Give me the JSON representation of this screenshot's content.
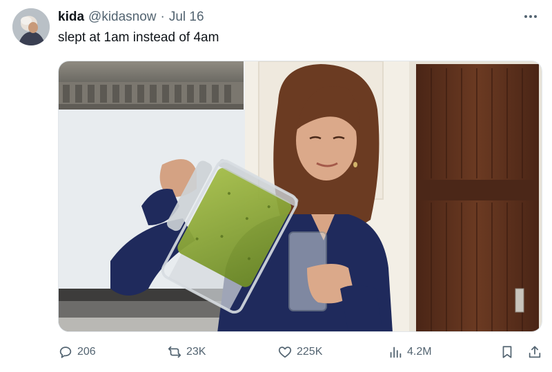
{
  "tweet": {
    "display_name": "kida",
    "handle": "@kidasnow",
    "separator": "·",
    "date": "Jul 16",
    "text": "slept at 1am instead of 4am"
  },
  "actions": {
    "replies": "206",
    "reposts": "23K",
    "likes": "225K",
    "views": "4.2M"
  },
  "icons": {
    "reply": "speech-bubble-icon",
    "repost": "repost-arrows-icon",
    "like": "heart-icon",
    "views": "bar-chart-icon",
    "bookmark": "bookmark-icon",
    "share": "share-upload-icon",
    "more": "ellipsis-icon"
  },
  "colors": {
    "text_primary": "#0f1419",
    "text_secondary": "#536471",
    "smoothie": "#8aa63a",
    "shirt": "#1f2a5c",
    "door": "#5a2f1c"
  }
}
